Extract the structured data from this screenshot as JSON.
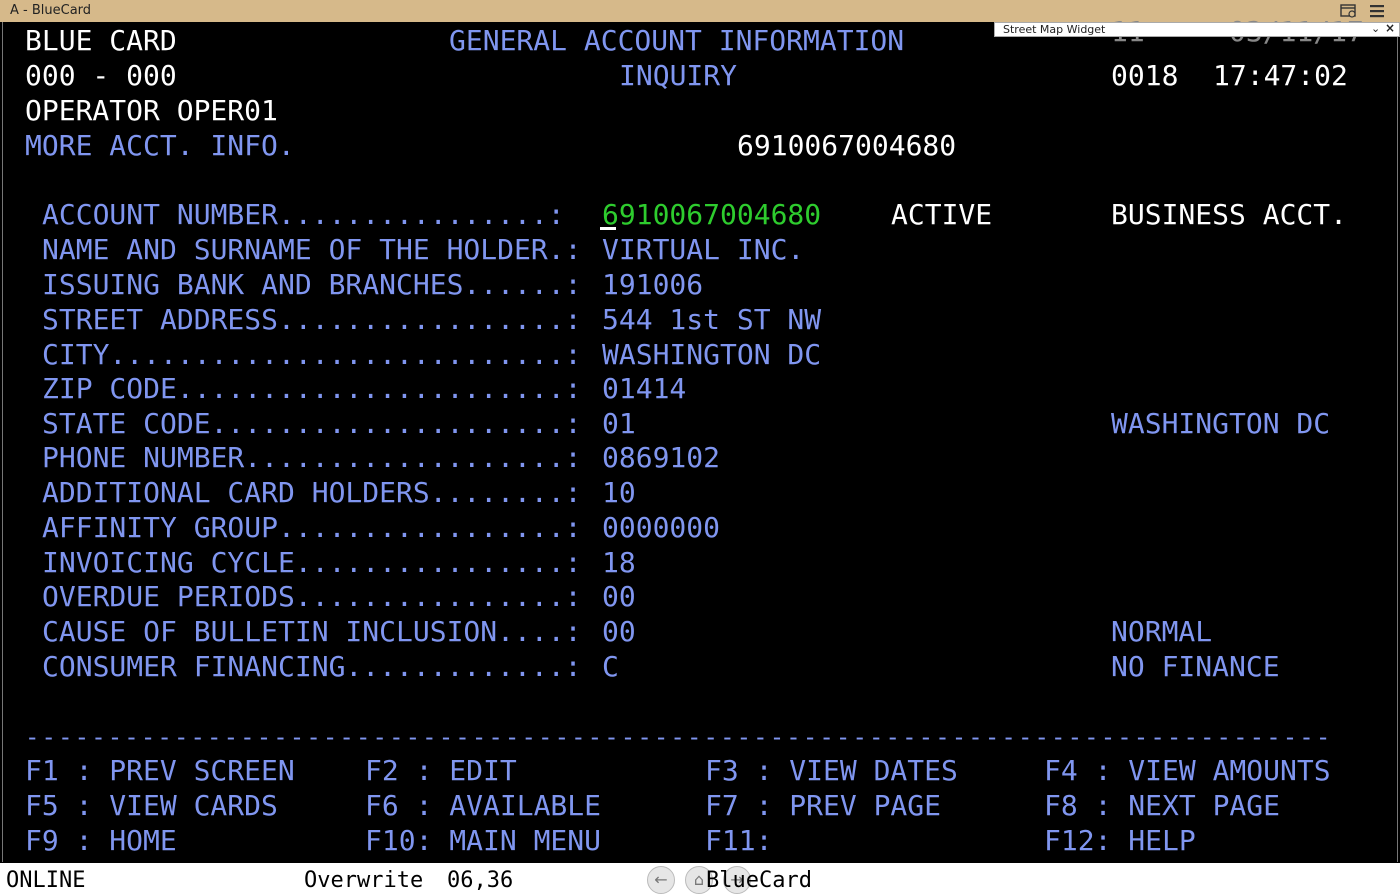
{
  "window": {
    "title": "A - BlueCard"
  },
  "widget": {
    "label": "Street Map Widget",
    "chevron": "⌄",
    "close": "×"
  },
  "header": {
    "app_name": "BLUE CARD",
    "title": "GENERAL ACCOUNT INFORMATION",
    "code": "000 - 000",
    "subtitle": "INQUIRY",
    "operator": "OPERATOR OPER01",
    "more_info": "MORE ACCT. INFO.",
    "account_ref": "6910067004680",
    "top_right_partial": "11     03/11/17",
    "terminal_id": "0018",
    "time": "17:47:02"
  },
  "fields": [
    {
      "label": "ACCOUNT NUMBER................: ",
      "value": "6910067004680",
      "extra": "ACTIVE",
      "right": "BUSINESS ACCT."
    },
    {
      "label": "NAME AND SURNAME OF THE HOLDER.: ",
      "value": "VIRTUAL INC.",
      "right": ""
    },
    {
      "label": "ISSUING BANK AND BRANCHES......: ",
      "value": "191006",
      "right": ""
    },
    {
      "label": "STREET ADDRESS.................: ",
      "value": "544 1st ST NW",
      "right": ""
    },
    {
      "label": "CITY...........................: ",
      "value": "WASHINGTON DC",
      "right": ""
    },
    {
      "label": "ZIP CODE.......................: ",
      "value": "01414",
      "right": ""
    },
    {
      "label": "STATE CODE.....................: ",
      "value": "01",
      "right": "WASHINGTON DC"
    },
    {
      "label": "PHONE NUMBER...................: ",
      "value": "0869102",
      "right": ""
    },
    {
      "label": "ADDITIONAL CARD HOLDERS........: ",
      "value": "10",
      "right": ""
    },
    {
      "label": "AFFINITY GROUP.................: ",
      "value": "0000000",
      "right": ""
    },
    {
      "label": "INVOICING CYCLE................: ",
      "value": "18",
      "right": ""
    },
    {
      "label": "OVERDUE PERIODS................: ",
      "value": "00",
      "right": ""
    },
    {
      "label": "CAUSE OF BULLETIN INCLUSION....: ",
      "value": "00",
      "right": "NORMAL"
    },
    {
      "label": "CONSUMER FINANCING.............: ",
      "value": "C",
      "right": "NO FINANCE"
    }
  ],
  "separator": "-------------------------------------------------------------------------------",
  "function_keys": [
    "F1 : PREV SCREEN",
    "F2 : EDIT",
    "F3 : VIEW DATES",
    "F4 : VIEW AMOUNTS",
    "F5 : VIEW CARDS",
    "F6 : AVAILABLE",
    "F7 : PREV PAGE",
    "F8 : NEXT PAGE",
    "F9 : HOME",
    "F10: MAIN MENU",
    "F11:",
    "F12: HELP"
  ],
  "status": {
    "mode": "ONLINE",
    "insert_mode": "Overwrite",
    "cursor_pos": "06,36",
    "session": "BlueCard"
  },
  "colors": {
    "title_bar": "#d6b98a",
    "label_blue": "#8096f0",
    "value_green": "#2ecc2e",
    "text_white": "#ffffff",
    "background": "#000000"
  }
}
